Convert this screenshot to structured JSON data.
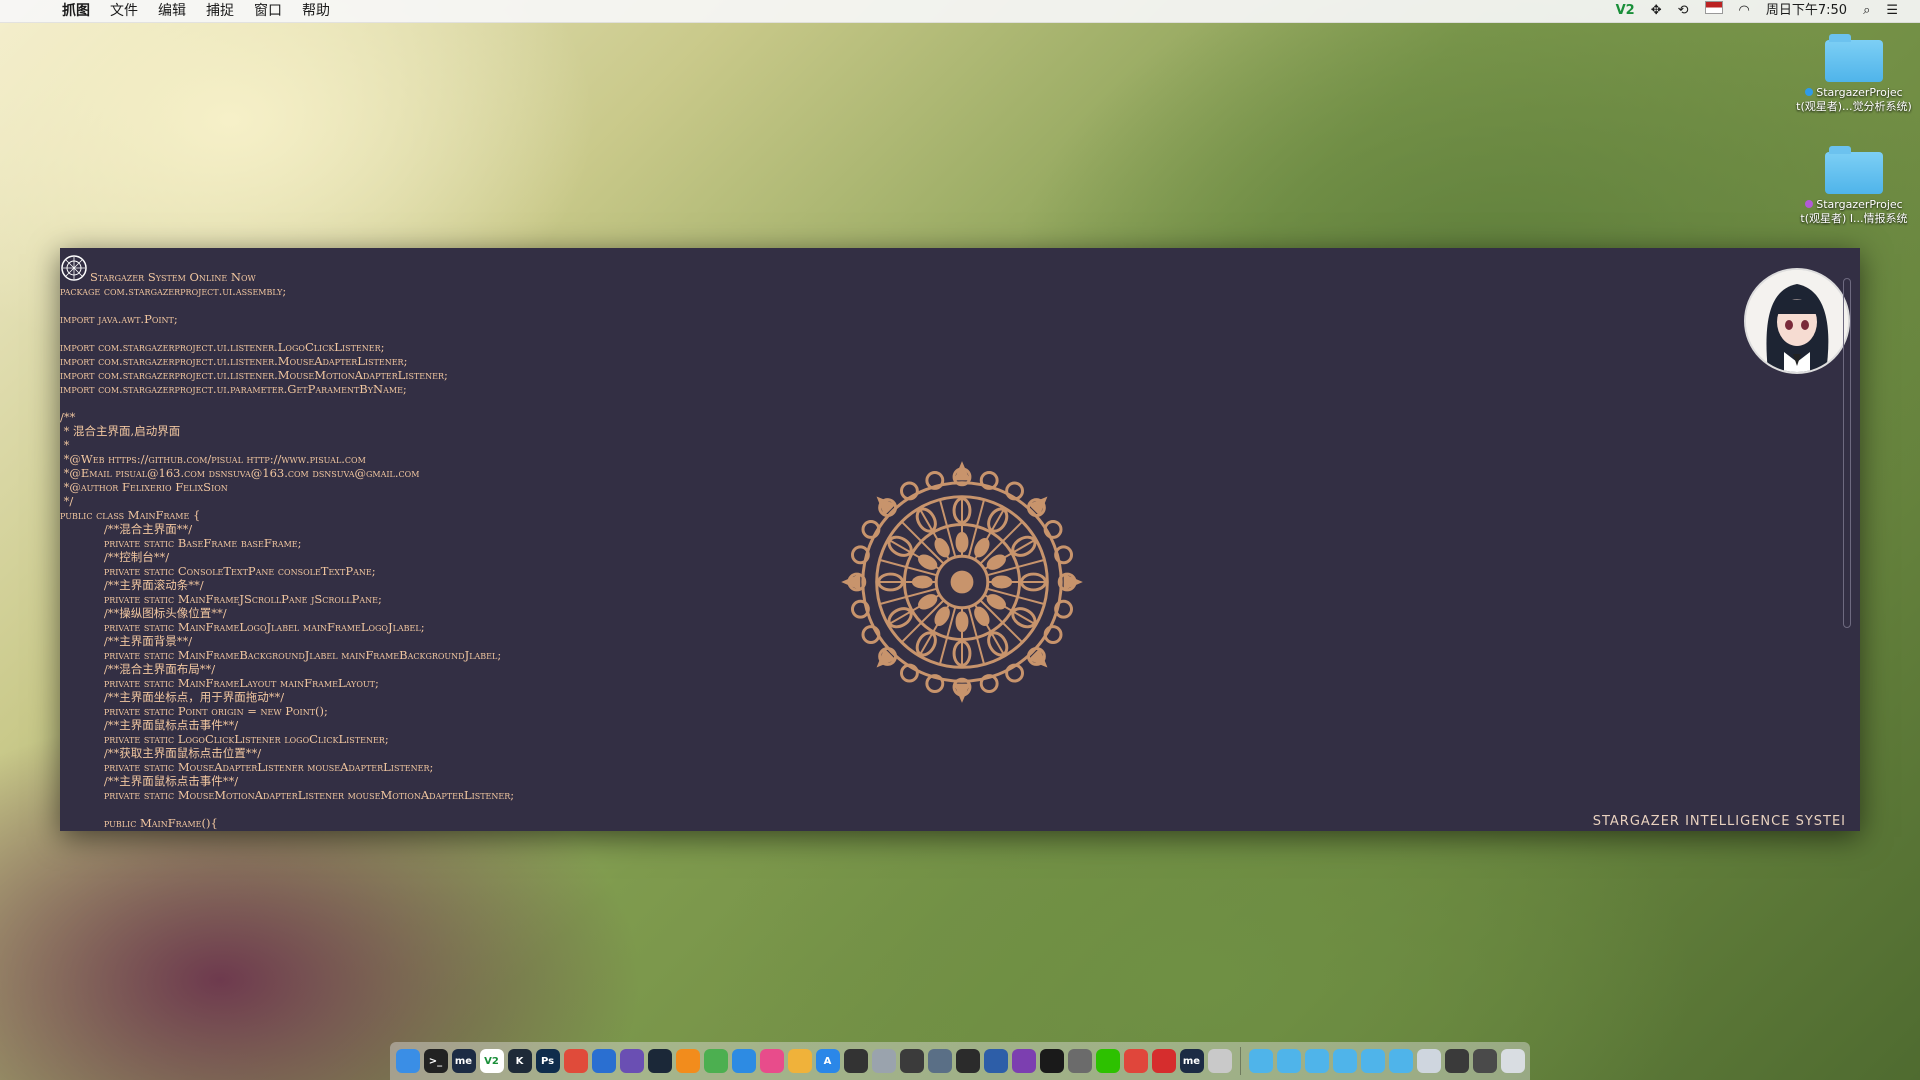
{
  "menubar": {
    "app_name": "抓图",
    "items": [
      "文件",
      "编辑",
      "捕捉",
      "窗口",
      "帮助"
    ],
    "tray": {
      "v2": "V2",
      "datetime": "周日下午7:50"
    }
  },
  "desktop": {
    "icons": [
      {
        "label_line1": "StargazerProjec",
        "label_line2": "t(观星者)...觉分析系统)",
        "tag_color": "#2f9be8"
      },
      {
        "label_line1": "StargazerProjec",
        "label_line2": "t(观星者) I...情报系统",
        "tag_color": "#b15ad6"
      }
    ]
  },
  "window": {
    "header": "Stargazer System Online Now",
    "code_lines": [
      "package com.stargazerproject.ui.assembly;",
      "",
      "import java.awt.Point;",
      "",
      "import com.stargazerproject.ui.listener.LogoClickListener;",
      "import com.stargazerproject.ui.listener.MouseAdapterListener;",
      "import com.stargazerproject.ui.listener.MouseMotionAdapterListener;",
      "import com.stargazerproject.ui.parameter.GetParamentByName;",
      "",
      "/**",
      " * 混合主界面,启动界面",
      " *",
      " *@Web https://github.com/pisual http://www.pisual.com",
      " *@Email pisual@163.com dsnsuva@163.com dsnsuva@gmail.com",
      " *@author Felixerio FelixSion",
      " */",
      "public class MainFrame {",
      "            /**混合主界面**/",
      "            private static BaseFrame baseFrame;",
      "            /**控制台**/",
      "            private static ConsoleTextPane consoleTextPane;",
      "            /**主界面滚动条**/",
      "            private static MainFrameJScrollPane jScrollPane;",
      "            /**操纵图标头像位置**/",
      "            private static MainFrameLogoJlabel mainFrameLogoJlabel;",
      "            /**主界面背景**/",
      "            private static MainFrameBackgroundJlabel mainFrameBackgroundJlabel;",
      "            /**混合主界面布局**/",
      "            private static MainFrameLayout mainFrameLayout;",
      "            /**主界面坐标点，用于界面拖动**/",
      "            private static Point origin = new Point();",
      "            /**主界面鼠标点击事件**/",
      "            private static LogoClickListener logoClickListener;",
      "            /**获取主界面鼠标点击位置**/",
      "            private static MouseAdapterListener mouseAdapterListener;",
      "            /**主界面鼠标点击事件**/",
      "            private static MouseMotionAdapterListener mouseMotionAdapterListener;",
      "",
      "            public MainFrame(){"
    ],
    "footer": "STARGAZER INTELLIGENCE SYSTEI"
  },
  "dock": {
    "icons": [
      {
        "name": "finder-icon",
        "color": "#3a8ee6",
        "glyph": ""
      },
      {
        "name": "terminal-icon",
        "color": "#222222",
        "glyph": "&gt;_"
      },
      {
        "name": "me-app-icon",
        "color": "#1c2b44",
        "glyph": "me"
      },
      {
        "name": "v2-app-icon",
        "color": "#ffffff",
        "glyph": "V2"
      },
      {
        "name": "kindle-icon",
        "color": "#1e2a38",
        "glyph": "K"
      },
      {
        "name": "photoshop-icon",
        "color": "#0f2c4c",
        "glyph": "Ps"
      },
      {
        "name": "clipboard-app-icon",
        "color": "#e04b3a",
        "glyph": ""
      },
      {
        "name": "xcode-icon",
        "color": "#2a6fd1",
        "glyph": ""
      },
      {
        "name": "github-icon",
        "color": "#6a4fb3",
        "glyph": ""
      },
      {
        "name": "steam-icon",
        "color": "#1b2838",
        "glyph": ""
      },
      {
        "name": "ibooks-icon",
        "color": "#f28c1c",
        "glyph": ""
      },
      {
        "name": "chrome-icon",
        "color": "#4caf50",
        "glyph": ""
      },
      {
        "name": "safari-icon",
        "color": "#2d8be3",
        "glyph": ""
      },
      {
        "name": "itunes-icon",
        "color": "#e84c8b",
        "glyph": ""
      },
      {
        "name": "photos-icon",
        "color": "#f0b23a",
        "glyph": ""
      },
      {
        "name": "app-store-icon",
        "color": "#2b87e8",
        "glyph": "A"
      },
      {
        "name": "dvd-player-icon",
        "color": "#333333",
        "glyph": ""
      },
      {
        "name": "mail-icon",
        "color": "#9aa3ad",
        "glyph": ""
      },
      {
        "name": "photo-viewer-icon",
        "color": "#3b3b3b",
        "glyph": ""
      },
      {
        "name": "preview-icon",
        "color": "#5a6f86",
        "glyph": ""
      },
      {
        "name": "console-icon",
        "color": "#2b2b2b",
        "glyph": ""
      },
      {
        "name": "keynote-icon",
        "color": "#2d5ea8",
        "glyph": ""
      },
      {
        "name": "affinity-icon",
        "color": "#7c3fb0",
        "glyph": ""
      },
      {
        "name": "activity-monitor-icon",
        "color": "#1a1a1a",
        "glyph": ""
      },
      {
        "name": "system-prefs-icon",
        "color": "#6b6b6b",
        "glyph": ""
      },
      {
        "name": "wechat-icon",
        "color": "#2dc100",
        "glyph": ""
      },
      {
        "name": "toutiao-icon",
        "color": "#e0463b",
        "glyph": ""
      },
      {
        "name": "netease-music-icon",
        "color": "#d62d2d",
        "glyph": ""
      },
      {
        "name": "me-app-2-icon",
        "color": "#1c2b44",
        "glyph": "me"
      },
      {
        "name": "installer-icon",
        "color": "#c9c9c9",
        "glyph": ""
      }
    ],
    "right_icons": [
      {
        "name": "applications-folder-icon",
        "color": "#4fb4ea"
      },
      {
        "name": "documents-folder-icon",
        "color": "#4fb4ea"
      },
      {
        "name": "screenshots-folder-icon",
        "color": "#4fb4ea"
      },
      {
        "name": "downloads-folder-icon",
        "color": "#4fb4ea"
      },
      {
        "name": "folder-icon",
        "color": "#4fb4ea"
      },
      {
        "name": "folder-2-icon",
        "color": "#4fb4ea"
      },
      {
        "name": "window-stack-icon",
        "color": "#cfd6df"
      },
      {
        "name": "display-stack-icon",
        "color": "#3a3a3a"
      },
      {
        "name": "screen-stack-icon",
        "color": "#4a4a4a"
      },
      {
        "name": "trash-icon",
        "color": "#d9dde2"
      }
    ]
  }
}
